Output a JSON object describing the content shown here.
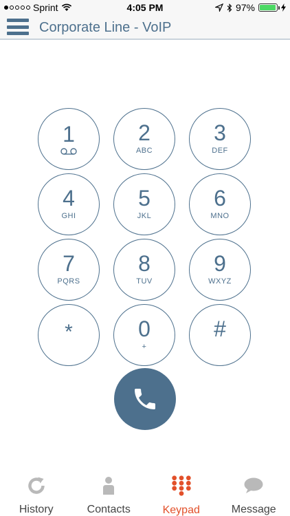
{
  "status": {
    "carrier": "Sprint",
    "time": "4:05 PM",
    "battery": "97%",
    "battery_level": 0.97,
    "signal_bars": 1
  },
  "header": {
    "title": "Corporate Line - VoIP"
  },
  "keypad": {
    "keys": [
      {
        "digit": "1",
        "letters": ""
      },
      {
        "digit": "2",
        "letters": "ABC"
      },
      {
        "digit": "3",
        "letters": "DEF"
      },
      {
        "digit": "4",
        "letters": "GHI"
      },
      {
        "digit": "5",
        "letters": "JKL"
      },
      {
        "digit": "6",
        "letters": "MNO"
      },
      {
        "digit": "7",
        "letters": "PQRS"
      },
      {
        "digit": "8",
        "letters": "TUV"
      },
      {
        "digit": "9",
        "letters": "WXYZ"
      },
      {
        "digit": "*",
        "letters": ""
      },
      {
        "digit": "0",
        "letters": "+"
      },
      {
        "digit": "#",
        "letters": ""
      }
    ]
  },
  "tabs": [
    {
      "label": "History",
      "icon": "history-icon"
    },
    {
      "label": "Contacts",
      "icon": "contacts-icon"
    },
    {
      "label": "Keypad",
      "icon": "keypad-icon"
    },
    {
      "label": "Message",
      "icon": "message-icon"
    }
  ],
  "colors": {
    "accent": "#4d708d",
    "active_tab": "#e2502a",
    "battery": "#4cd964"
  }
}
